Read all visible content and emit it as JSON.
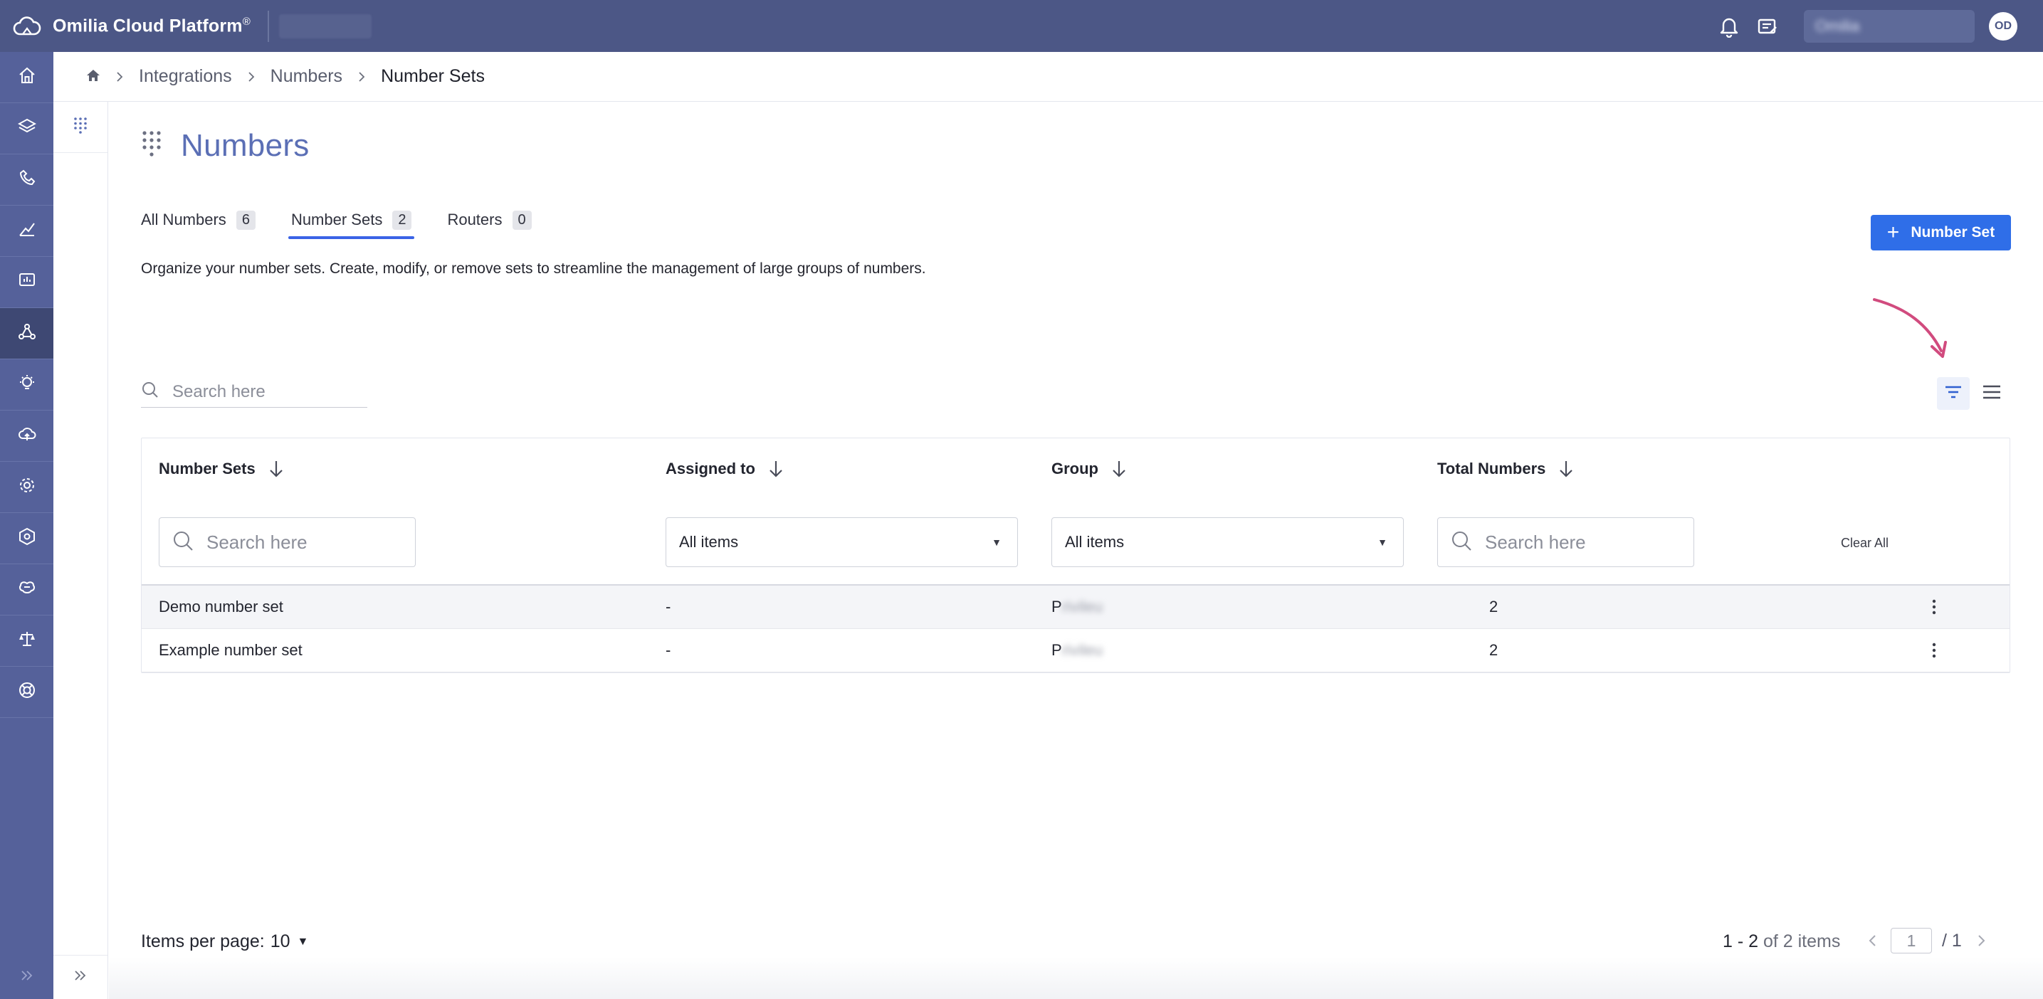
{
  "app": {
    "brand_name": "Omilia Cloud Platform",
    "brand_mark": "®",
    "account_name": "Omilia",
    "avatar_initials": "OD"
  },
  "breadcrumb": {
    "items": [
      "Integrations",
      "Numbers",
      "Number Sets"
    ]
  },
  "page": {
    "title": "Numbers",
    "description": "Organize your number sets. Create, modify, or remove sets to streamline the management of large groups of numbers.",
    "primary_button": "Number Set",
    "search_placeholder": "Search here"
  },
  "tabs": [
    {
      "label": "All Numbers",
      "count": "6"
    },
    {
      "label": "Number Sets",
      "count": "2",
      "active": true
    },
    {
      "label": "Routers",
      "count": "0"
    }
  ],
  "table": {
    "columns": [
      "Number Sets",
      "Assigned to",
      "Group",
      "Total Numbers"
    ],
    "filters": {
      "number_sets_placeholder": "Search here",
      "assigned_to_value": "All items",
      "group_value": "All items",
      "total_numbers_placeholder": "Search here",
      "clear_all": "Clear All"
    },
    "rows": [
      {
        "name": "Demo number set",
        "assigned_to": "-",
        "group_visible": "P",
        "group_hidden": "rivileu",
        "total": "2"
      },
      {
        "name": "Example number set",
        "assigned_to": "-",
        "group_visible": "P",
        "group_hidden": "rivileu",
        "total": "2"
      }
    ]
  },
  "pagination": {
    "per_page_label": "Items per page:",
    "per_page_value": "10",
    "range": "1 - 2",
    "of_text": "of 2 items",
    "page_value": "1",
    "total_pages": "/ 1"
  },
  "colors": {
    "topbar": "#4c5786",
    "rail": "#55619a",
    "rail_active": "#3e4873",
    "accent": "#2f6ee8",
    "title": "#5b6fb5",
    "annotation_arrow": "#d14b7e"
  },
  "icons": {
    "rail": [
      "home-icon",
      "layers-icon",
      "phone-icon",
      "analytics-icon",
      "monitor-icon",
      "integrations-icon",
      "lightbulb-icon",
      "cloud-upload-icon",
      "settings-gear-icon",
      "hexagon-settings-icon",
      "brain-icon",
      "scale-icon",
      "support-icon"
    ]
  }
}
